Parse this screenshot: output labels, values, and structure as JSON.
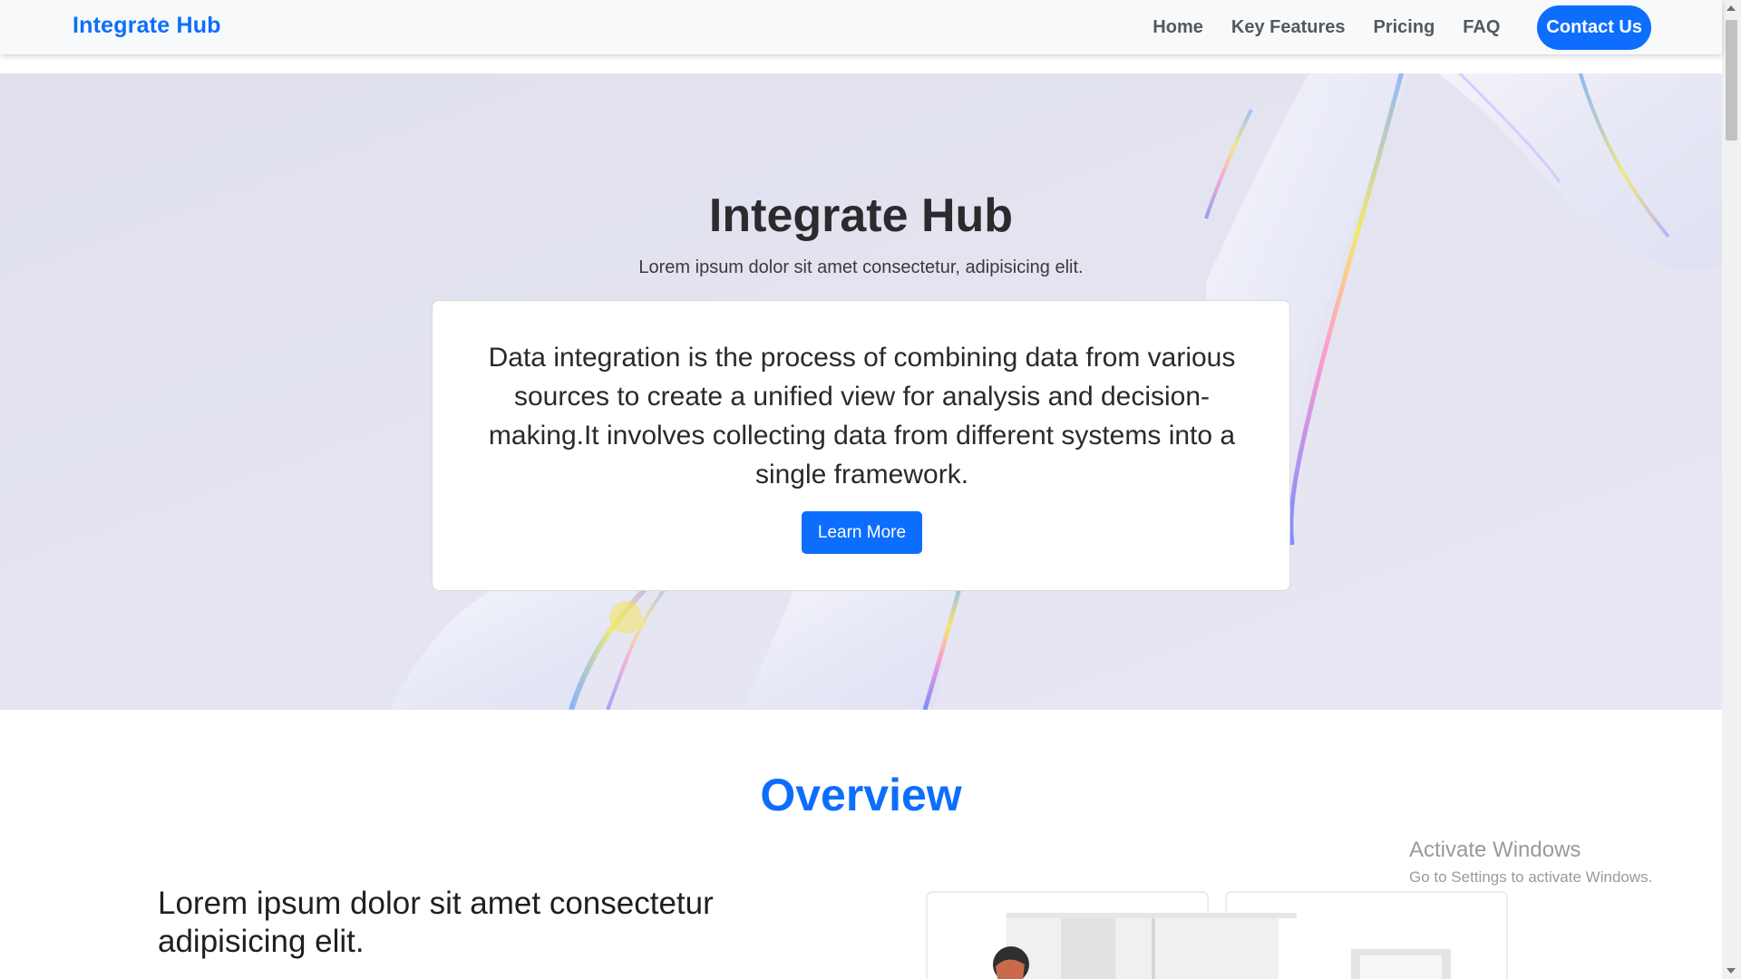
{
  "navbar": {
    "brand": "Integrate Hub",
    "links": [
      "Home",
      "Key Features",
      "Pricing",
      "FAQ"
    ],
    "contact_label": "Contact Us"
  },
  "hero": {
    "title": "Integrate Hub",
    "subtitle": "Lorem ipsum dolor sit amet consectetur, adipisicing elit.",
    "card_text": "Data integration is the process of combining data from various sources to create a unified view for analysis and decision-making.It involves collecting data from different systems into a single framework.",
    "button_label": "Learn More"
  },
  "overview": {
    "title": "Overview",
    "heading": "Lorem ipsum dolor sit amet consectetur adipisicing elit."
  },
  "watermark": {
    "line1": "Activate Windows",
    "line2": "Go to Settings to activate Windows."
  },
  "colors": {
    "accent": "#0d6efd",
    "hero_bg": "#e4e4f1",
    "nav_bg": "#f8f9fa"
  }
}
